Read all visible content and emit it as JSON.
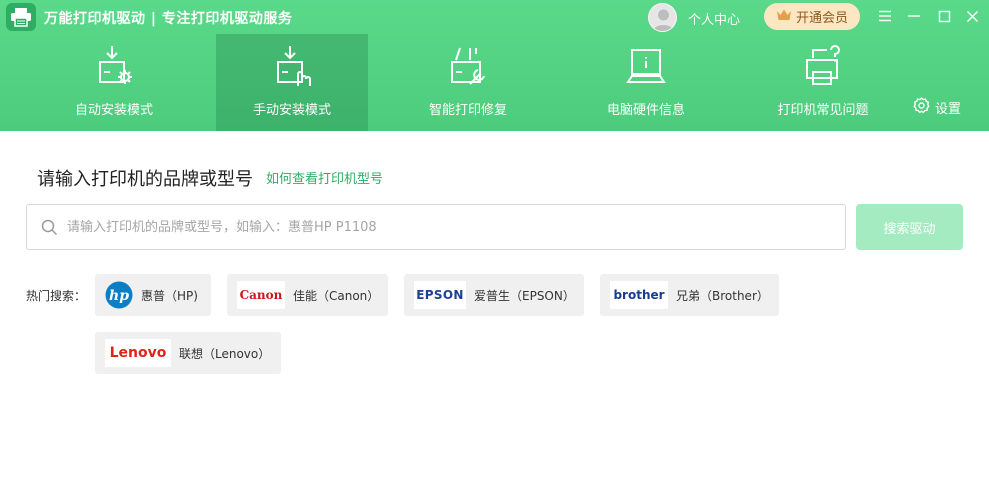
{
  "app": {
    "title": "万能打印机驱动 | 专注打印机驱动服务",
    "user_center": "个人中心",
    "vip_button": "开通会员"
  },
  "nav": {
    "items": [
      {
        "label": "自动安装模式",
        "icon": "auto-install-icon",
        "active": false
      },
      {
        "label": "手动安装模式",
        "icon": "manual-install-icon",
        "active": true
      },
      {
        "label": "智能打印修复",
        "icon": "repair-icon",
        "active": false
      },
      {
        "label": "电脑硬件信息",
        "icon": "hardware-info-icon",
        "active": false
      },
      {
        "label": "打印机常见问题",
        "icon": "faq-icon",
        "active": false
      }
    ],
    "settings": "设置"
  },
  "search": {
    "title": "请输入打印机的品牌或型号",
    "help_link": "如何查看打印机型号",
    "placeholder": "请输入打印机的品牌或型号，如输入：惠普HP P1108",
    "value": "",
    "button": "搜索驱动"
  },
  "hot": {
    "label": "热门搜索：",
    "brands": [
      {
        "name": "惠普（HP)",
        "logo": "hp-logo"
      },
      {
        "name": "佳能（Canon）",
        "logo": "canon-logo",
        "logo_text": "Canon"
      },
      {
        "name": "爱普生（EPSON）",
        "logo": "epson-logo",
        "logo_text": "EPSON"
      },
      {
        "name": "兄弟（Brother）",
        "logo": "brother-logo",
        "logo_text": "brother"
      },
      {
        "name": "联想（Lenovo）",
        "logo": "lenovo-logo",
        "logo_text": "Lenovo"
      }
    ]
  },
  "colors": {
    "brand_green": "#4ccc7c",
    "link_green": "#2fae63",
    "search_button": "#a4ebc1",
    "vip_bg": "#fde7c3"
  }
}
